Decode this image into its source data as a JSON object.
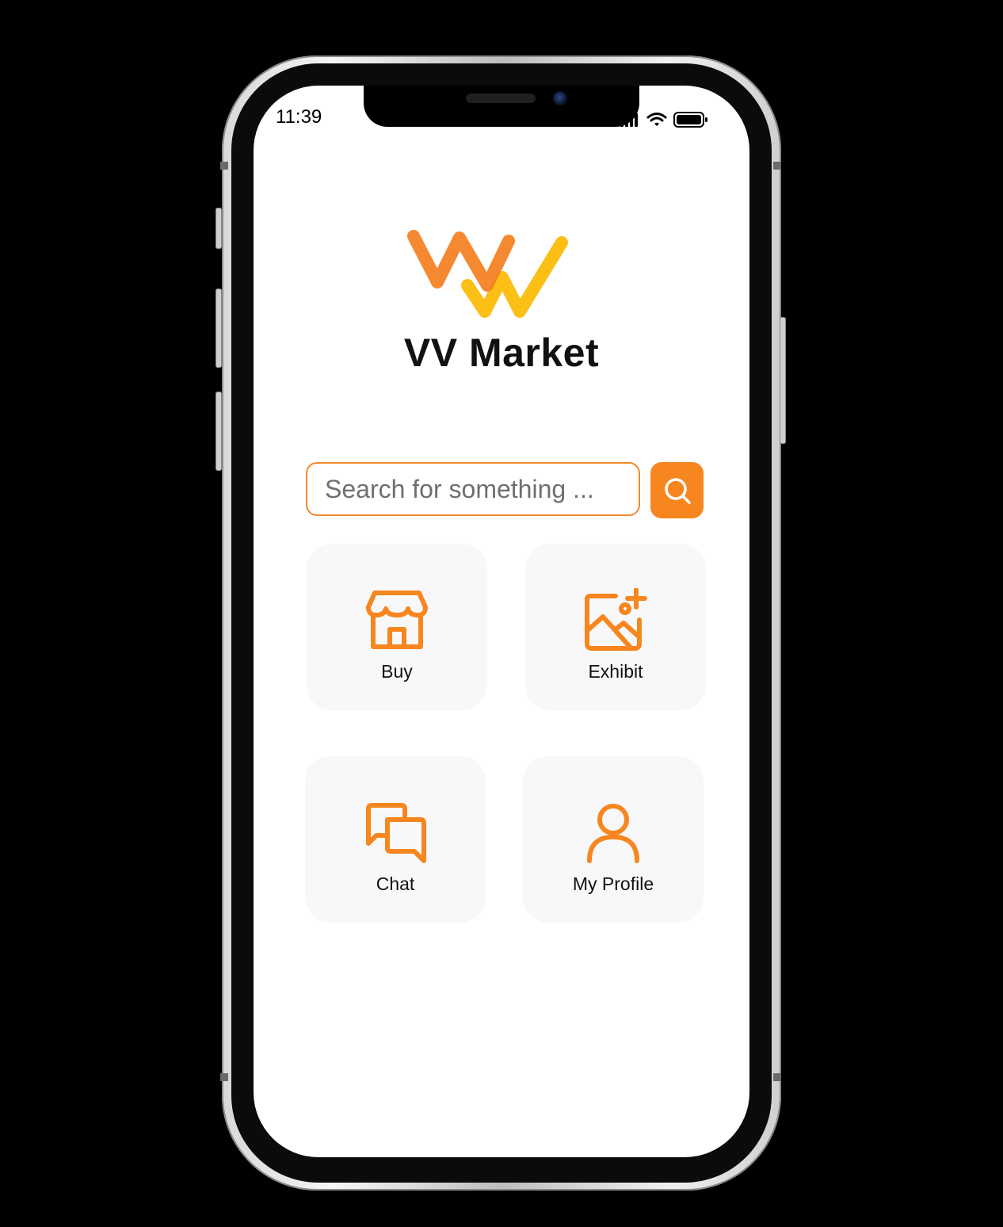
{
  "status_bar": {
    "time": "11:39",
    "icons": [
      "signal-icon",
      "wifi-icon",
      "battery-icon"
    ]
  },
  "app": {
    "title": "VV Market",
    "logo": "vv-market-logo"
  },
  "search": {
    "placeholder": "Search for something ...",
    "value": "",
    "button_icon": "search-icon"
  },
  "tiles": [
    {
      "label": "Buy",
      "icon": "storefront-icon"
    },
    {
      "label": "Exhibit",
      "icon": "image-add-icon"
    },
    {
      "label": "Chat",
      "icon": "chat-bubbles-icon"
    },
    {
      "label": "My Profile",
      "icon": "user-icon"
    }
  ],
  "colors": {
    "accent": "#f7861f",
    "logo_orange": "#f47f20",
    "logo_yellow": "#fbbc0a",
    "tile_background": "#f8f8fa",
    "background": "#ffffff"
  }
}
